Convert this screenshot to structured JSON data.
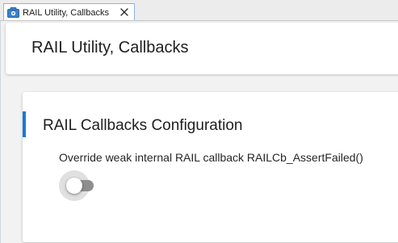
{
  "tab": {
    "label": "RAIL Utility, Callbacks",
    "icon": "component-editor-icon",
    "close_icon": "close-icon"
  },
  "header": {
    "title": "RAIL Utility, Callbacks"
  },
  "section": {
    "title": "RAIL Callbacks Configuration",
    "option": {
      "label": "Override weak internal RAIL callback RAILCb_AssertFailed()",
      "enabled": false
    }
  },
  "colors": {
    "accent": "#1b79d1",
    "toggle_track_off": "#8e8e8e",
    "tab_icon": "#3b82c9"
  }
}
